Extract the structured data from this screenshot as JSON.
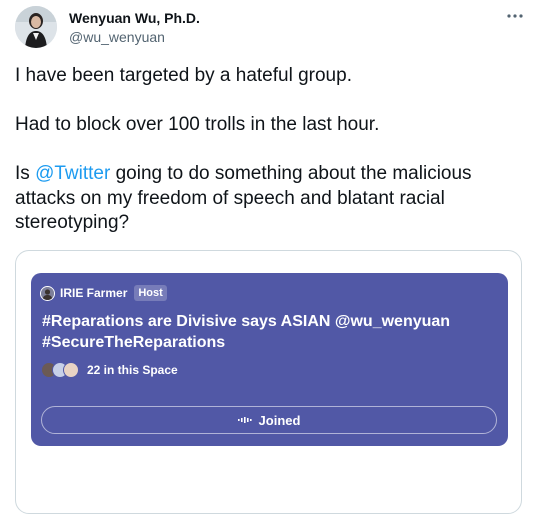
{
  "author": {
    "name": "Wenyuan Wu, Ph.D.",
    "handle": "@wu_wenyuan"
  },
  "tweet": {
    "line1": "I have been targeted by a hateful group.",
    "line2": "Had to block over 100 trolls in the last hour.",
    "line3_prefix": "Is ",
    "line3_mention": "@Twitter",
    "line3_suffix": " going to do something about the malicious attacks on my freedom of speech and blatant racial stereotyping?"
  },
  "space_card": {
    "host_name": "IRIE Farmer",
    "host_badge": "Host",
    "title": "#Reparations are Divisive says ASIAN @wu_wenyuan #SecureTheReparations",
    "listener_count": "22 in this Space",
    "joined_label": "Joined",
    "background_color": "#5158a6"
  },
  "colors": {
    "link": "#1d9bf0",
    "text": "#0f1419",
    "muted": "#536471"
  },
  "icons": {
    "more": "more-horizontal-icon",
    "audio": "audio-waveform-icon"
  }
}
